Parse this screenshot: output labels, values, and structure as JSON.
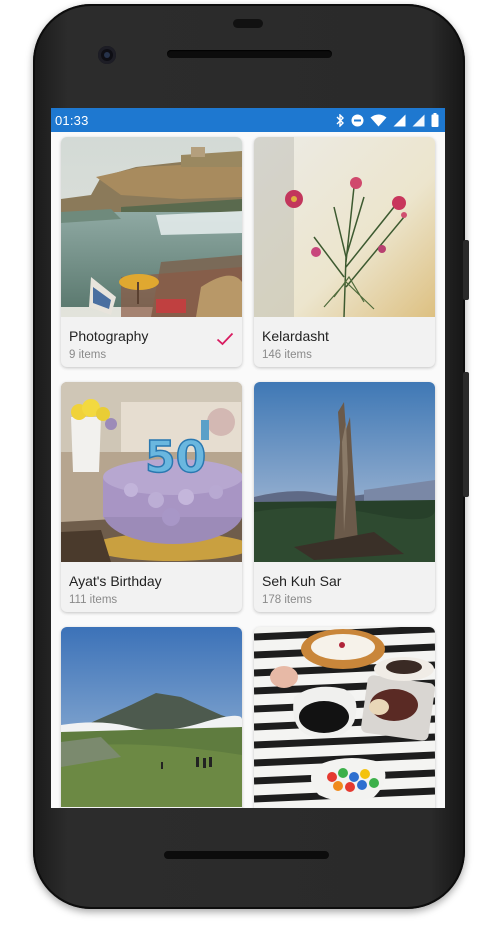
{
  "status_bar": {
    "time": "01:33",
    "icons": [
      "bluetooth-icon",
      "do-not-disturb-icon",
      "wifi-icon",
      "signal-icon",
      "battery-icon"
    ]
  },
  "albums": [
    {
      "title": "Photography",
      "count": "9 items",
      "selected": true
    },
    {
      "title": "Kelardasht",
      "count": "146 items",
      "selected": false
    },
    {
      "title": "Ayat's Birthday",
      "count": "111 items",
      "selected": false
    },
    {
      "title": "Seh Kuh Sar",
      "count": "178 items",
      "selected": false
    },
    {
      "title": "",
      "count": "",
      "selected": false
    },
    {
      "title": "",
      "count": "",
      "selected": false
    }
  ],
  "colors": {
    "status_bar": "#1e78d0",
    "check": "#d81b60",
    "card": "#f2f2f2"
  }
}
